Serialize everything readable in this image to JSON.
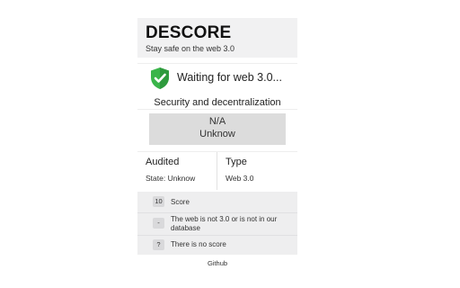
{
  "header": {
    "title": "DESCORE",
    "tagline": "Stay safe on the web 3.0"
  },
  "status": {
    "icon": "shield-check-icon",
    "text": "Waiting for web 3.0...",
    "icon_color": "#3ab54a"
  },
  "section": {
    "title": "Security and decentralization"
  },
  "score_box": {
    "value": "N/A",
    "label": "Unknow"
  },
  "info": {
    "audited": {
      "title": "Audited",
      "value": "State: Unknow"
    },
    "type": {
      "title": "Type",
      "value": "Web 3.0"
    }
  },
  "legend": [
    {
      "badge": "10",
      "text": "Score"
    },
    {
      "badge": "-",
      "text": "The web is not 3.0 or is not in our database"
    },
    {
      "badge": "?",
      "text": "There is no score"
    }
  ],
  "footer": {
    "link": "Github"
  }
}
